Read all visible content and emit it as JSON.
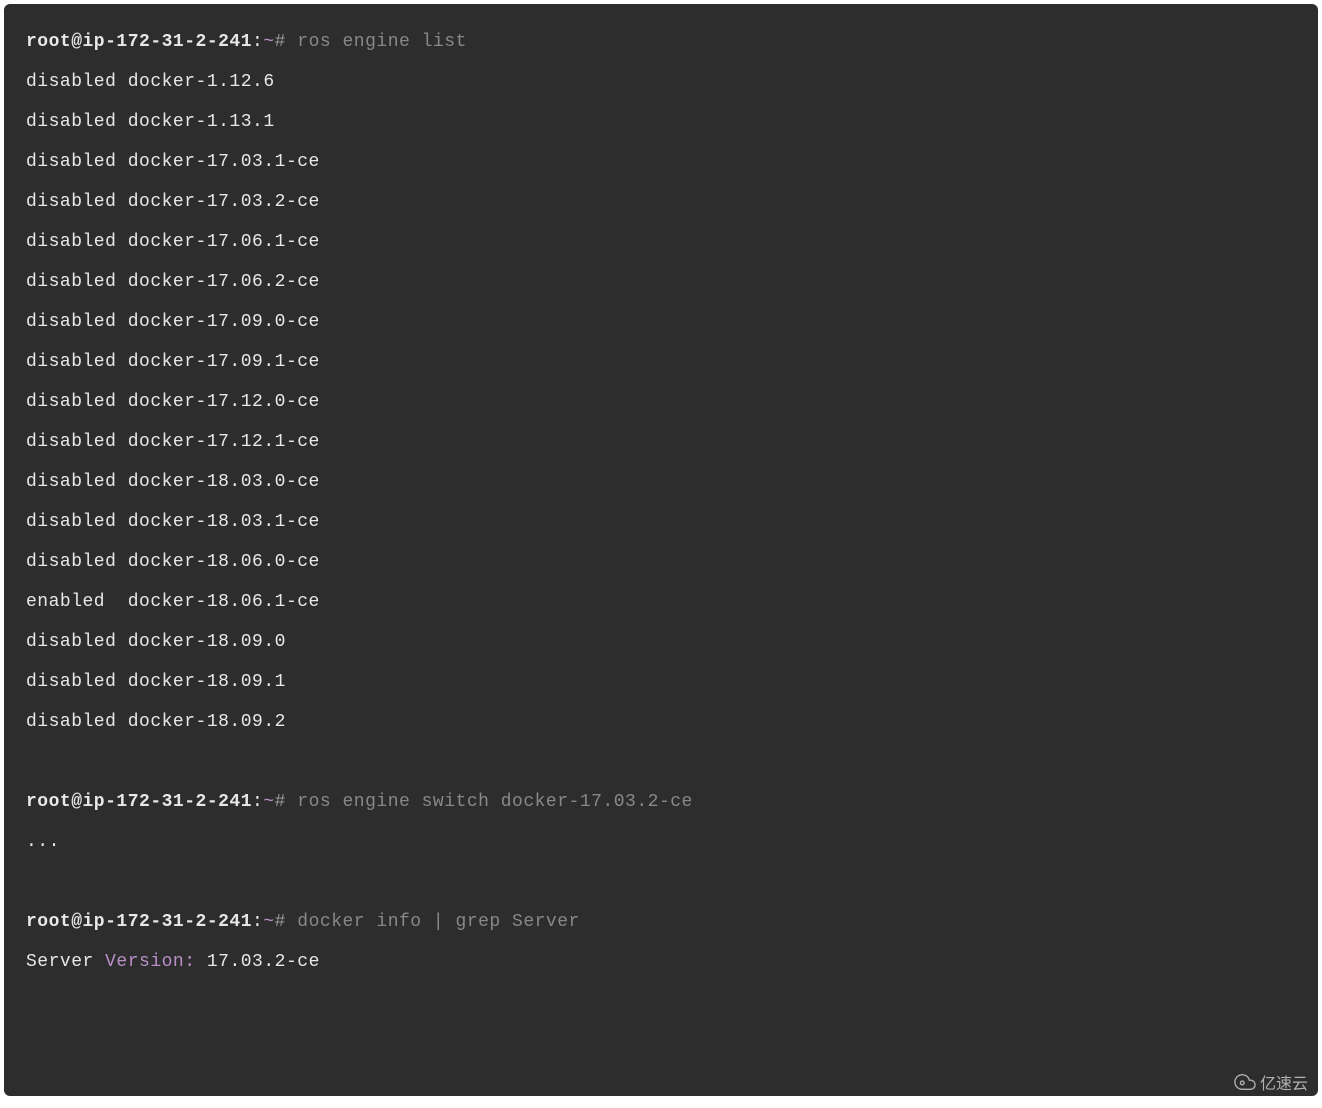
{
  "prompts": [
    {
      "user_host": "root@ip-172-31-2-241",
      "colon": ":",
      "tilde": "~",
      "hash": "#",
      "command": " ros engine list"
    },
    {
      "user_host": "root@ip-172-31-2-241",
      "colon": ":",
      "tilde": "~",
      "hash": "#",
      "command": " ros engine switch docker-17.03.2-ce"
    },
    {
      "user_host": "root@ip-172-31-2-241",
      "colon": ":",
      "tilde": "~",
      "hash": "#",
      "command": " docker info | grep Server"
    }
  ],
  "engine_list": [
    "disabled docker-1.12.6",
    "disabled docker-1.13.1",
    "disabled docker-17.03.1-ce",
    "disabled docker-17.03.2-ce",
    "disabled docker-17.06.1-ce",
    "disabled docker-17.06.2-ce",
    "disabled docker-17.09.0-ce",
    "disabled docker-17.09.1-ce",
    "disabled docker-17.12.0-ce",
    "disabled docker-17.12.1-ce",
    "disabled docker-18.03.0-ce",
    "disabled docker-18.03.1-ce",
    "disabled docker-18.06.0-ce",
    "enabled  docker-18.06.1-ce",
    "disabled docker-18.09.0",
    "disabled docker-18.09.1",
    "disabled docker-18.09.2"
  ],
  "ellipsis": "...",
  "server_line": {
    "prefix": "Server ",
    "keyword": "Version:",
    "value": " 17.03.2-ce"
  },
  "watermark": "亿速云"
}
